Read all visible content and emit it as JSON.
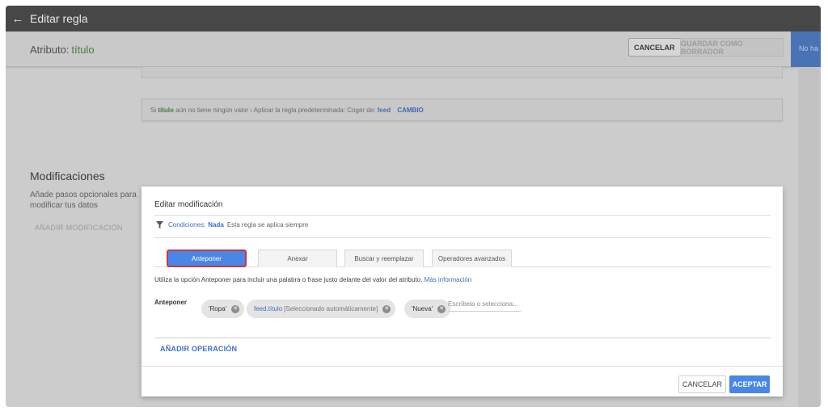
{
  "topbar": {
    "back_icon": "←",
    "title": "Editar regla"
  },
  "subbar": {
    "attr_label": "Atributo:",
    "attr_value": "título",
    "cancel_label": "CANCELAR",
    "draft_label": "GUARDAR COMO BORRADOR",
    "side_label": "No ha"
  },
  "rule": {
    "prefix": "Si",
    "attr": "título",
    "middle": "aún no tiene ningún valor › Aplicar la regla predeterminada: Coger de:",
    "source": "feed",
    "link": "CAMBIO"
  },
  "modifications": {
    "title": "Modificaciones",
    "desc": "Añade pasos opcionales para modificar tus datos",
    "add_label": "AÑADIR MODIFICACIÓN"
  },
  "dialog": {
    "title": "Editar modificación",
    "conditions_label": "Condiciones:",
    "conditions_value": "Nada",
    "conditions_text": "Esta regla se aplica siempre",
    "tabs": [
      {
        "label": "Anteponer"
      },
      {
        "label": "Anexar"
      },
      {
        "label": "Buscar y reemplazar"
      },
      {
        "label": "Operadores avanzados"
      }
    ],
    "help_text": "Utiliza la opción Anteponer para incluir una palabra o frase justo delante del valor del atributo.",
    "help_link": "Más información",
    "field_label": "Anteponer",
    "chips": {
      "c1": "'Ropa'",
      "c2_feed": "feed.título",
      "c2_auto": "[Seleccionado automáticamente]",
      "c3": "'Nueva'"
    },
    "input_placeholder": "Escríbela o selecciona...",
    "add_operation": "AÑADIR OPERACIÓN",
    "cancel_label": "CANCELAR",
    "accept_label": "ACEPTAR"
  },
  "colors": {
    "accent": "#4a86e8",
    "highlight_border": "#c8373d",
    "green": "#3f7f3f"
  }
}
